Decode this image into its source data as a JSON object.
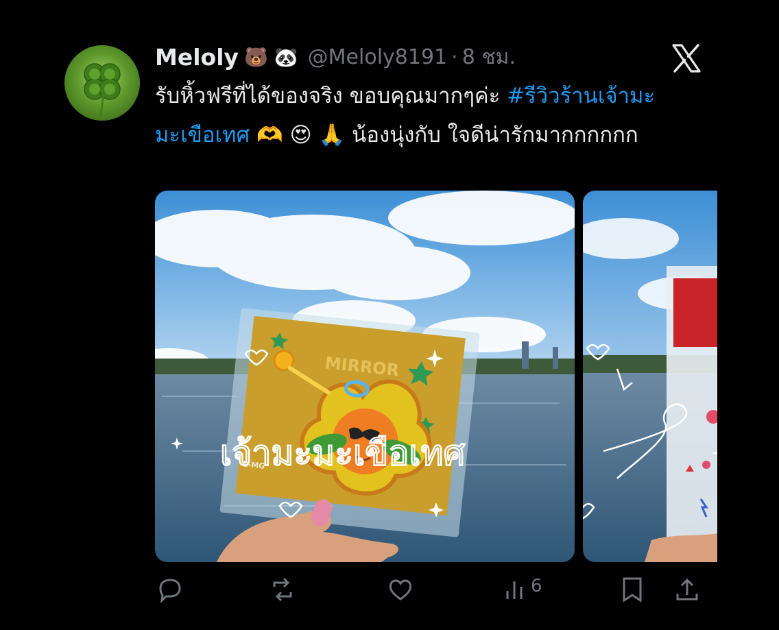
{
  "tweet": {
    "author_name": "Meloly",
    "author_emojis": "🐻 🐼",
    "handle": "@Meloly8191",
    "separator": "·",
    "time": "8 ชม.",
    "text_part1": "รับหิ้วฟรีที่ได้ของจริง ขอบคุณมากๆค่ะ ",
    "hashtag": "#รีวิวร้านเจ้ามะมะเขือเทศ",
    "text_emojis": " 🫶 😍 🙏 ",
    "text_part2": "น้องนุ่งกับ ใจดีน่ารักมากกกกกก"
  },
  "media": {
    "image1": {
      "card_label": "MIRROR",
      "overlay_text": "เจ้ามะมะเขือเทศ",
      "brand_label": "G-MG"
    }
  },
  "actions": {
    "views_count": "6"
  },
  "icons": [
    "avatar-clover-icon",
    "x-logo-icon",
    "reply-icon",
    "retweet-icon",
    "like-icon",
    "views-icon",
    "bookmark-icon",
    "share-icon"
  ],
  "colors": {
    "background": "#000000",
    "text": "#e7e9ea",
    "muted": "#71767b",
    "link": "#1d9bf0"
  }
}
